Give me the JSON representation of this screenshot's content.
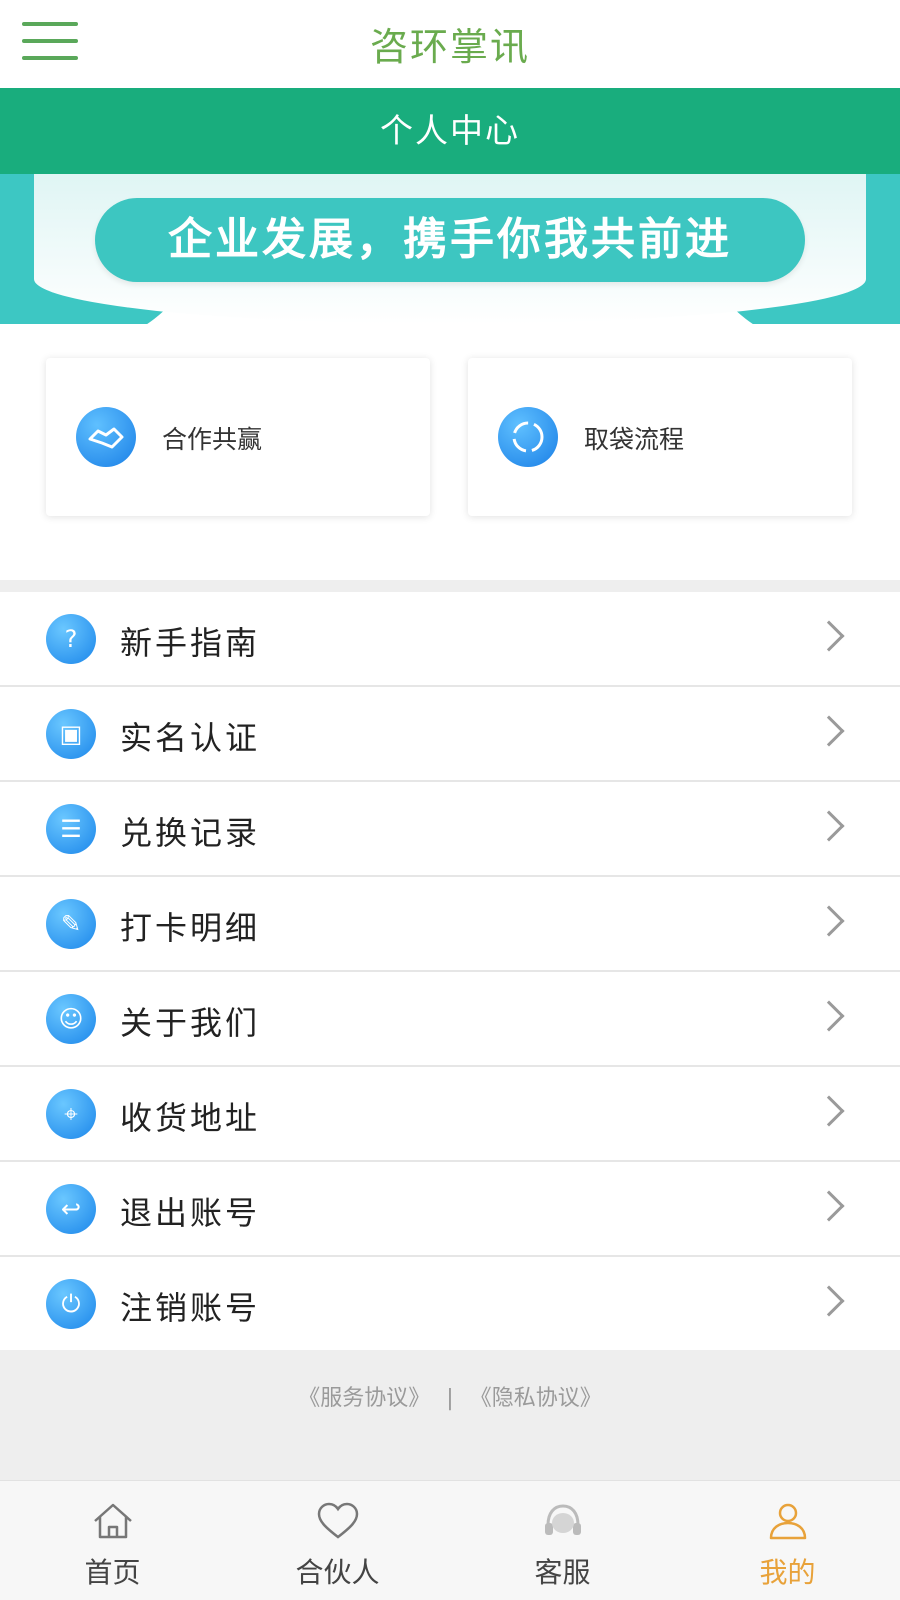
{
  "app": {
    "title": "咨环掌讯"
  },
  "header": {
    "title": "个人中心"
  },
  "banner": {
    "slogan": "企业发展，携手你我共前进"
  },
  "cards": [
    {
      "label": "合作共赢",
      "icon": "handshake-icon"
    },
    {
      "label": "取袋流程",
      "icon": "refresh-cycle-icon"
    }
  ],
  "menu": {
    "items": [
      {
        "label": "新手指南",
        "icon": "question-chat-icon"
      },
      {
        "label": "实名认证",
        "icon": "id-card-icon"
      },
      {
        "label": "兑换记录",
        "icon": "record-list-icon"
      },
      {
        "label": "打卡明细",
        "icon": "checkin-icon"
      },
      {
        "label": "关于我们",
        "icon": "about-user-icon"
      },
      {
        "label": "收货地址",
        "icon": "location-pin-icon"
      },
      {
        "label": "退出账号",
        "icon": "logout-icon"
      },
      {
        "label": "注销账号",
        "icon": "power-icon"
      }
    ]
  },
  "footer": {
    "service_agreement": "《服务协议》",
    "separator": "|",
    "privacy_agreement": "《隐私协议》"
  },
  "tabbar": {
    "tabs": [
      {
        "label": "首页",
        "icon": "home-icon"
      },
      {
        "label": "合伙人",
        "icon": "heart-icon"
      },
      {
        "label": "客服",
        "icon": "headset-icon"
      },
      {
        "label": "我的",
        "icon": "user-icon",
        "active": true
      }
    ],
    "active_color": "#e8a23a"
  },
  "colors": {
    "primary_green": "#19ad7d",
    "title_green": "#6aab4e",
    "banner_teal": "#3dc6c1",
    "icon_blue": "#1b86ea"
  }
}
